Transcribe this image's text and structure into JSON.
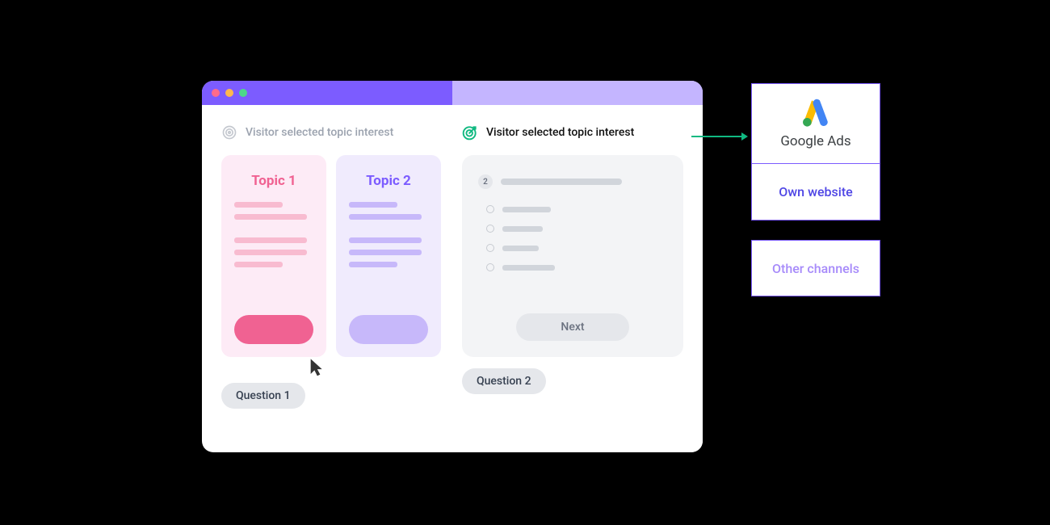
{
  "heading_left": "Visitor selected topic interest",
  "heading_right": "Visitor selected topic interest",
  "topics": {
    "one": "Topic 1",
    "two": "Topic 2"
  },
  "question_panel": {
    "number": "2",
    "next_label": "Next"
  },
  "chips": {
    "q1": "Question 1",
    "q2": "Question 2"
  },
  "destinations": {
    "google_ads": "Google Ads",
    "own_website": "Own website",
    "other_channels": "Other channels"
  }
}
